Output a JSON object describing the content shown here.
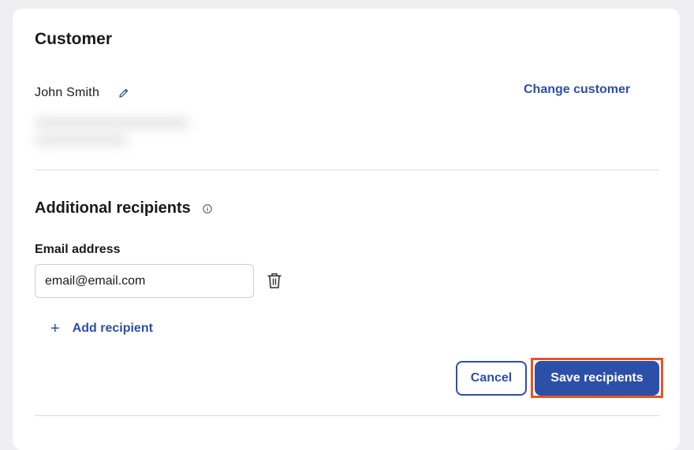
{
  "card": {
    "title": "Customer",
    "customer_name": "John Smith",
    "change_customer_label": "Change customer"
  },
  "recipients": {
    "section_title": "Additional recipients",
    "email_label": "Email address",
    "email_value": "email@email.com",
    "add_label": "Add recipient",
    "add_symbol": "+"
  },
  "actions": {
    "cancel_label": "Cancel",
    "save_label": "Save recipients"
  },
  "colors": {
    "accent": "#2c4fa8",
    "highlight": "#e8541e"
  },
  "icons": {
    "edit": "pencil-icon",
    "info": "info-icon",
    "delete": "trash-icon"
  }
}
